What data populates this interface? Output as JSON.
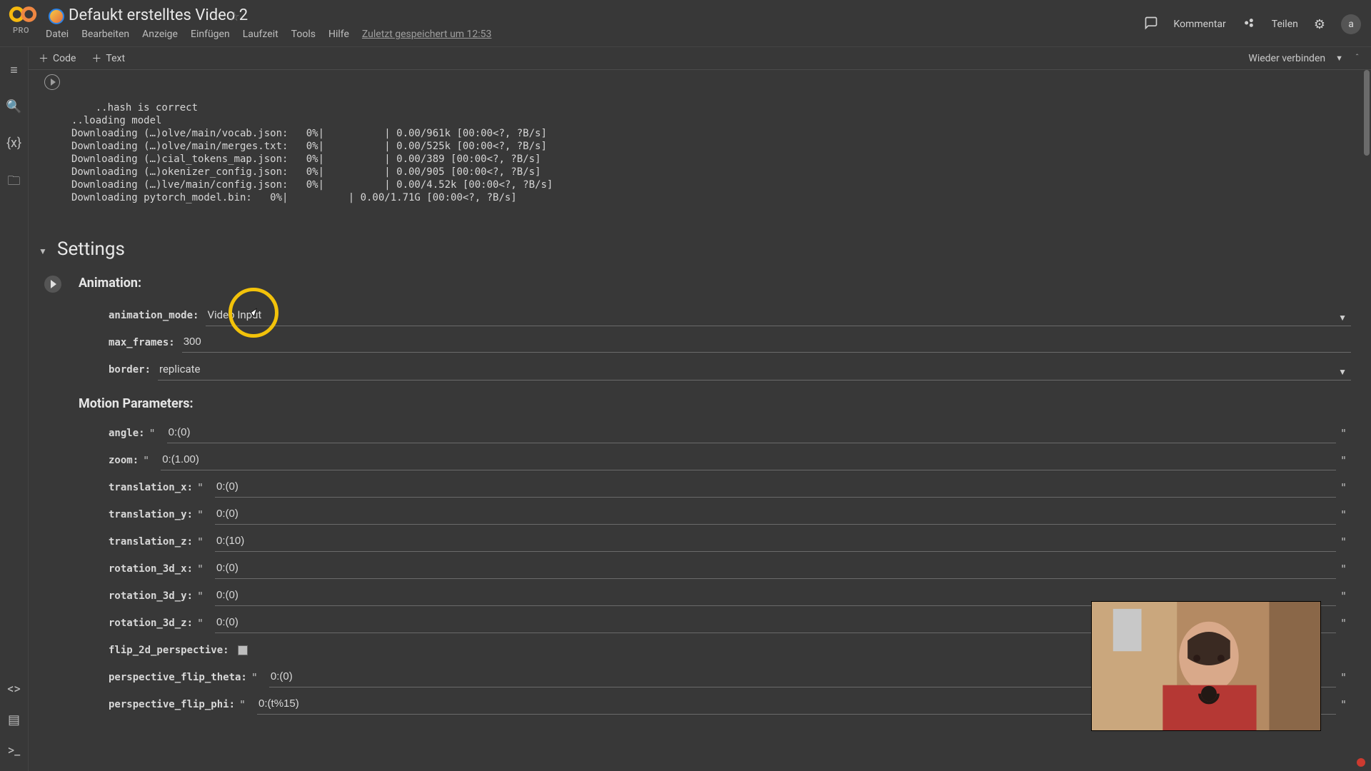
{
  "header": {
    "pro": "PRO",
    "title": "Defaukt erstelltes Video 2",
    "menus": [
      "Datei",
      "Bearbeiten",
      "Anzeige",
      "Einfügen",
      "Laufzeit",
      "Tools",
      "Hilfe"
    ],
    "autosave": "Zuletzt gespeichert um 12:53",
    "comment": "Kommentar",
    "share": "Teilen",
    "avatar": "a"
  },
  "toolbar": {
    "code": "Code",
    "text": "Text",
    "reconnect": "Wieder verbinden"
  },
  "output": {
    "lines": "..hash is correct\n..loading model\nDownloading (…)olve/main/vocab.json:   0%|          | 0.00/961k [00:00<?, ?B/s]\nDownloading (…)olve/main/merges.txt:   0%|          | 0.00/525k [00:00<?, ?B/s]\nDownloading (…)cial_tokens_map.json:   0%|          | 0.00/389 [00:00<?, ?B/s]\nDownloading (…)okenizer_config.json:   0%|          | 0.00/905 [00:00<?, ?B/s]\nDownloading (…)lve/main/config.json:   0%|          | 0.00/4.52k [00:00<?, ?B/s]\nDownloading pytorch_model.bin:   0%|          | 0.00/1.71G [00:00<?, ?B/s]"
  },
  "section_title": "Settings",
  "anim": {
    "title": "Animation:",
    "fields": {
      "animation_mode": {
        "label": "animation_mode:",
        "value": "Video Input",
        "type": "select"
      },
      "max_frames": {
        "label": "max_frames:",
        "value": "300",
        "type": "text"
      },
      "border": {
        "label": "border:",
        "value": "replicate",
        "type": "select"
      }
    }
  },
  "motion": {
    "title": "Motion Parameters:",
    "fields": {
      "angle": {
        "label": "angle:",
        "value": "0:(0)"
      },
      "zoom": {
        "label": "zoom:",
        "value": "0:(1.00)"
      },
      "translation_x": {
        "label": "translation_x:",
        "value": "0:(0)"
      },
      "translation_y": {
        "label": "translation_y:",
        "value": "0:(0)"
      },
      "translation_z": {
        "label": "translation_z:",
        "value": "0:(10)"
      },
      "rotation_3d_x": {
        "label": "rotation_3d_x:",
        "value": "0:(0)"
      },
      "rotation_3d_y": {
        "label": "rotation_3d_y:",
        "value": "0:(0)"
      },
      "rotation_3d_z": {
        "label": "rotation_3d_z:",
        "value": "0:(0)"
      },
      "flip_2d_perspective": {
        "label": "flip_2d_perspective:",
        "checkbox": true
      },
      "perspective_flip_theta": {
        "label": "perspective_flip_theta:",
        "value": "0:(0)"
      },
      "perspective_flip_phi": {
        "label": "perspective_flip_phi:",
        "value": "0:(t%15)"
      }
    }
  }
}
